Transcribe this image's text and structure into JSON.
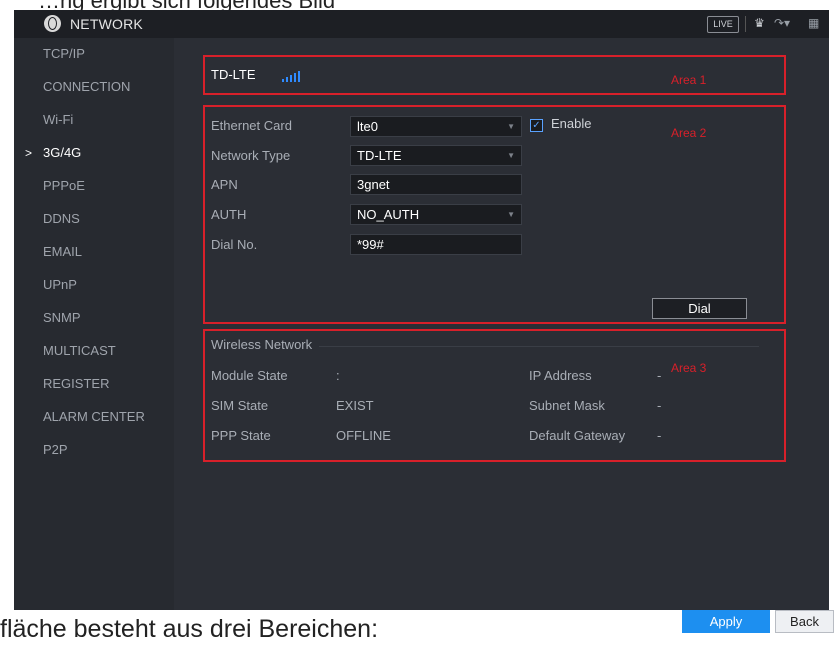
{
  "doc": {
    "caption_top": "…ng ergibt sich folgendes Bild",
    "caption_bottom": "fläche besteht aus drei Bereichen:"
  },
  "titlebar": {
    "title": "NETWORK",
    "live_label": "LIVE",
    "user_icon": "user-icon",
    "exit_icon": "exit-icon",
    "grid_icon": "grid-icon"
  },
  "sidebar": {
    "items": [
      {
        "label": "TCP/IP",
        "active": false
      },
      {
        "label": "CONNECTION",
        "active": false
      },
      {
        "label": "Wi-Fi",
        "active": false
      },
      {
        "label": "3G/4G",
        "active": true
      },
      {
        "label": "PPPoE",
        "active": false
      },
      {
        "label": "DDNS",
        "active": false
      },
      {
        "label": "EMAIL",
        "active": false
      },
      {
        "label": "UPnP",
        "active": false
      },
      {
        "label": "SNMP",
        "active": false
      },
      {
        "label": "MULTICAST",
        "active": false
      },
      {
        "label": "REGISTER",
        "active": false
      },
      {
        "label": "ALARM CENTER",
        "active": false
      },
      {
        "label": "P2P",
        "active": false
      }
    ],
    "active_marker": ">"
  },
  "area1": {
    "network_label": "TD-LTE",
    "tag": "Area 1"
  },
  "area2": {
    "tag": "Area 2",
    "ethernet_card_label": "Ethernet Card",
    "ethernet_card_value": "lte0",
    "enable_label": "Enable",
    "enable_checked": true,
    "network_type_label": "Network Type",
    "network_type_value": "TD-LTE",
    "apn_label": "APN",
    "apn_value": "3gnet",
    "auth_label": "AUTH",
    "auth_value": "NO_AUTH",
    "dial_no_label": "Dial No.",
    "dial_no_value": "*99#",
    "dial_button": "Dial"
  },
  "area3": {
    "tag": "Area 3",
    "section_title": "Wireless Network",
    "module_state_label": "Module State",
    "module_state_value": ":",
    "sim_state_label": "SIM State",
    "sim_state_value": "EXIST",
    "ppp_state_label": "PPP State",
    "ppp_state_value": "OFFLINE",
    "ip_address_label": "IP Address",
    "ip_address_value": "-",
    "subnet_mask_label": "Subnet Mask",
    "subnet_mask_value": "-",
    "default_gateway_label": "Default Gateway",
    "default_gateway_value": "-"
  },
  "footer": {
    "apply_label": "Apply",
    "back_label": "Back"
  },
  "colors": {
    "accent": "#1d8ff0",
    "highlight_border": "#d8202a",
    "signal": "#2f8bff",
    "panel_bg": "#2b2e35"
  }
}
